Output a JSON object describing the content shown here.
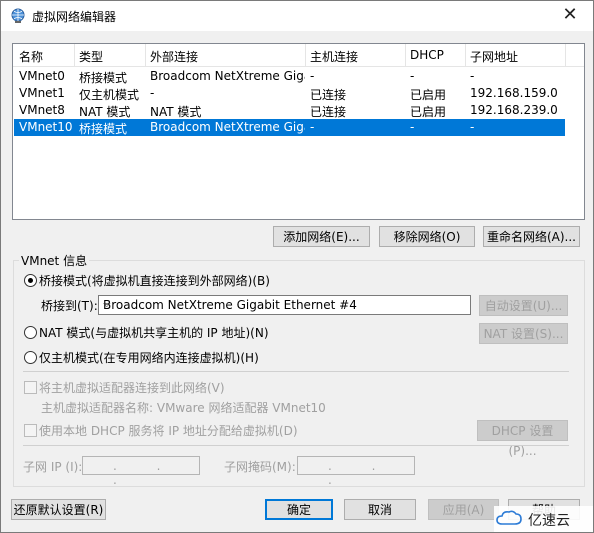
{
  "window": {
    "title": "虚拟网络编辑器",
    "close": "✕"
  },
  "table": {
    "columns": [
      "名称",
      "类型",
      "外部连接",
      "主机连接",
      "DHCP",
      "子网地址"
    ],
    "rows": [
      [
        "VMnet0",
        "桥接模式",
        "Broadcom NetXtreme Gigabi...",
        "-",
        "-",
        "-"
      ],
      [
        "VMnet1",
        "仅主机模式",
        "-",
        "已连接",
        "已启用",
        "192.168.159.0"
      ],
      [
        "VMnet8",
        "NAT 模式",
        "NAT 模式",
        "已连接",
        "已启用",
        "192.168.239.0"
      ],
      [
        "VMnet10",
        "桥接模式",
        "Broadcom NetXtreme Gigabi...",
        "-",
        "-",
        "-"
      ]
    ],
    "selected_row": 3
  },
  "table_buttons": {
    "add": "添加网络(E)...",
    "remove": "移除网络(O)",
    "rename": "重命名网络(A)..."
  },
  "vmnet": {
    "group_title": "VMnet 信息",
    "bridge_radio": "桥接模式(将虚拟机直接连接到外部网络)(B)",
    "bridge_to_label": "桥接到(T):",
    "bridge_to_value": "Broadcom NetXtreme Gigabit Ethernet #4",
    "auto_settings": "自动设置(U)...",
    "nat_radio": "NAT 模式(与虚拟机共享主机的 IP 地址)(N)",
    "nat_settings": "NAT 设置(S)...",
    "hostonly_radio": "仅主机模式(在专用网络内连接虚拟机)(H)",
    "connect_adapter": "将主机虚拟适配器连接到此网络(V)",
    "adapter_name": "主机虚拟适配器名称: VMware 网络适配器 VMnet10",
    "use_dhcp": "使用本地 DHCP 服务将 IP 地址分配给虚拟机(D)",
    "dhcp_settings": "DHCP 设置(P)...",
    "subnet_ip_label": "子网 IP (I):",
    "subnet_mask_label": "子网掩码(M):",
    "ip_dots": ". . ."
  },
  "footer": {
    "restore": "还原默认设置(R)",
    "ok": "确定",
    "cancel": "取消",
    "apply": "应用(A)",
    "help": "帮助"
  },
  "watermark": {
    "text": "亿速云"
  }
}
